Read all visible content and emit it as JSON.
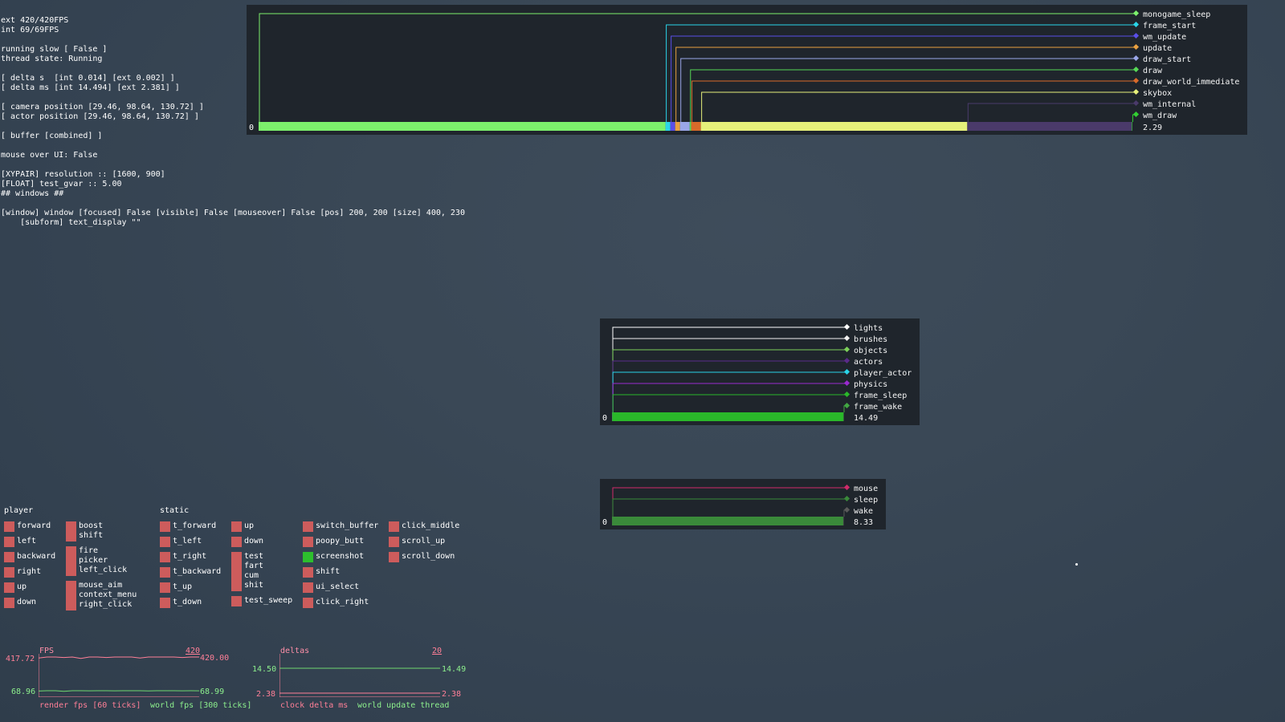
{
  "debug_lines": [
    "ext 420/420FPS",
    "int 69/69FPS",
    "",
    "running slow [ False ]",
    "thread state: Running",
    "",
    "[ delta s  [int 0.014] [ext 0.002] ]",
    "[ delta ms [int 14.494] [ext 2.381] ]",
    "",
    "[ camera position [29.46, 98.64, 130.72] ]",
    "[ actor position [29.46, 98.64, 130.72] ]",
    "",
    "[ buffer [combined] ]",
    "",
    "mouse over UI: False",
    "",
    "[XYPAIR] resolution :: [1600, 900]",
    "[FLOAT] test_gvar :: 5.00",
    "## windows ##",
    "",
    "[window] window [focused] False [visible] False [mouseover] False [pos] 200, 200 [size] 400, 230",
    "    [subform] text_display \"\""
  ],
  "profiler_main": {
    "zero_label": "0",
    "total_label": "2.29",
    "series": [
      {
        "name": "monogame_sleep",
        "color": "#7cf06c",
        "value": 0.84
      },
      {
        "name": "frame_start",
        "color": "#2ad4e8",
        "value": 0.01
      },
      {
        "name": "wm_update",
        "color": "#5a4fe8",
        "value": 0.01
      },
      {
        "name": "update",
        "color": "#e8a040",
        "value": 0.01
      },
      {
        "name": "draw_start",
        "color": "#9aa6e8",
        "value": 0.02
      },
      {
        "name": "draw",
        "color": "#56d856",
        "value": 0.003
      },
      {
        "name": "draw_world_immediate",
        "color": "#d86a2a",
        "value": 0.02
      },
      {
        "name": "skybox",
        "color": "#e6f07a",
        "value": 0.55
      },
      {
        "name": "wm_internal",
        "color": "#4a3a6a",
        "value": 0.34
      },
      {
        "name": "wm_draw",
        "color": "#32d032",
        "value": 0.001
      }
    ]
  },
  "profiler_world": {
    "zero_label": "0",
    "total_label": "14.49",
    "series": [
      {
        "name": "lights",
        "color": "#ffffff",
        "value": 0.001
      },
      {
        "name": "brushes",
        "color": "#f0f0f0",
        "value": 0.001
      },
      {
        "name": "objects",
        "color": "#7cd05a",
        "value": 0.002
      },
      {
        "name": "actors",
        "color": "#5a2a8a",
        "value": 0.001
      },
      {
        "name": "player_actor",
        "color": "#2ad4e8",
        "value": 0.002
      },
      {
        "name": "physics",
        "color": "#9a2ad0",
        "value": 0.001
      },
      {
        "name": "frame_sleep",
        "color": "#2ab82a",
        "value": 14.49
      },
      {
        "name": "frame_wake",
        "color": "#42a842",
        "value": 0.001
      }
    ]
  },
  "profiler_input": {
    "zero_label": "0",
    "total_label": "8.33",
    "series": [
      {
        "name": "mouse",
        "color": "#d02a6a",
        "value": 0.001
      },
      {
        "name": "sleep",
        "color": "#3a8a3a",
        "value": 8.33
      },
      {
        "name": "wake",
        "color": "#5a5a5a",
        "value": 0.001
      }
    ]
  },
  "bindings": {
    "player_title": "player",
    "static_title": "static",
    "groups": [
      {
        "id": "col1",
        "items": [
          {
            "label": "forward",
            "on": false
          },
          {
            "label": "left",
            "on": false
          },
          {
            "label": "backward",
            "on": false
          },
          {
            "label": "right",
            "on": false
          },
          {
            "label": "up",
            "on": false
          },
          {
            "label": "down",
            "on": false
          }
        ]
      },
      {
        "id": "col2",
        "items": [
          {
            "label": "boost\nshift",
            "on": false
          },
          {
            "label": "fire\npicker\nleft_click",
            "on": false
          },
          {
            "label": "mouse_aim\ncontext_menu\nright_click",
            "on": false
          }
        ]
      },
      {
        "id": "col3",
        "items": [
          {
            "label": "t_forward",
            "on": false
          },
          {
            "label": "t_left",
            "on": false
          },
          {
            "label": "t_right",
            "on": false
          },
          {
            "label": "t_backward",
            "on": false
          },
          {
            "label": "t_up",
            "on": false
          },
          {
            "label": "t_down",
            "on": false
          }
        ]
      },
      {
        "id": "col4",
        "items": [
          {
            "label": "up",
            "on": false
          },
          {
            "label": "down",
            "on": false
          },
          {
            "label": "test\nfart\ncum\nshit",
            "on": false
          },
          {
            "label": "test_sweep",
            "on": false
          }
        ]
      },
      {
        "id": "col5",
        "items": [
          {
            "label": "switch_buffer",
            "on": false
          },
          {
            "label": "poopy_butt",
            "on": false
          },
          {
            "label": "screenshot",
            "on": true
          },
          {
            "label": "shift",
            "on": false
          },
          {
            "label": "ui_select",
            "on": false
          },
          {
            "label": "click_right",
            "on": false
          }
        ]
      },
      {
        "id": "col6",
        "items": [
          {
            "label": "click_middle",
            "on": false
          },
          {
            "label": "scroll_up",
            "on": false
          },
          {
            "label": "scroll_down",
            "on": false
          }
        ]
      }
    ]
  },
  "fps_graph": {
    "title": "FPS",
    "max_label": "420",
    "top_left": "417.72",
    "top_right": "420.00",
    "bottom_left": "68.96",
    "bottom_right": "68.99",
    "legend_a": "render fps [60 ticks]",
    "legend_b": "world fps [300 ticks]",
    "series_a": [
      418,
      420,
      420,
      419,
      420,
      417,
      420,
      420,
      419,
      420,
      420,
      420,
      418,
      420,
      420,
      420,
      420,
      419,
      420,
      420
    ],
    "series_b": [
      68.96,
      69,
      69,
      68.9,
      69,
      69,
      68.99,
      69,
      69,
      68.98,
      69,
      69,
      69,
      68.97,
      69,
      69,
      69,
      68.99,
      69,
      68.99
    ]
  },
  "delta_graph": {
    "title": "deltas",
    "max_label": "20",
    "top_left": "14.50",
    "top_right": "14.49",
    "bottom_left": "2.38",
    "bottom_right": "2.38",
    "legend_a": "clock delta ms",
    "legend_b": "world update thread"
  }
}
